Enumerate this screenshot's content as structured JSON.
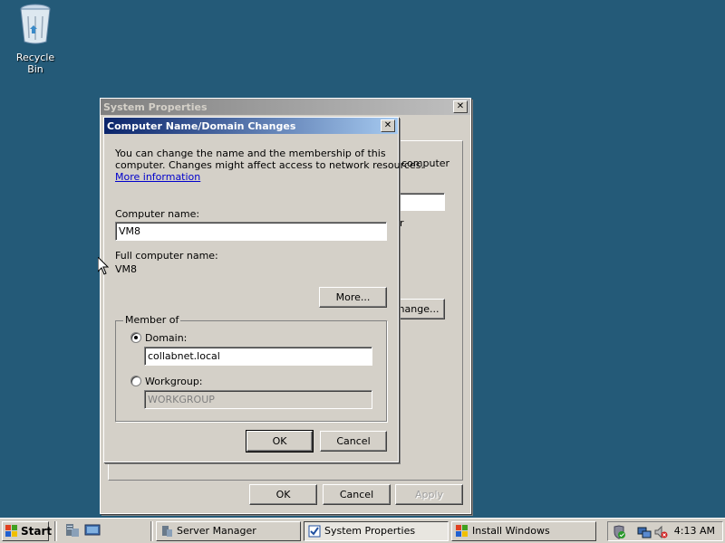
{
  "desktop": {
    "icons": [
      {
        "label": "Recycle Bin",
        "icon": "recycle-bin-icon"
      }
    ]
  },
  "system_properties": {
    "title": "System Properties",
    "partial_texts": {
      "computer": "computer",
      "r": "r"
    },
    "change_button": "hange...",
    "ok": "OK",
    "cancel": "Cancel",
    "apply": "Apply"
  },
  "dialog": {
    "title": "Computer Name/Domain Changes",
    "intro_line1": "You can change the name and the membership of this",
    "intro_line2": "computer. Changes might affect access to network resources.",
    "more_info_link": "More information",
    "computer_name_label": "Computer name:",
    "computer_name_value": "VM8",
    "full_name_label": "Full computer name:",
    "full_name_value": "VM8",
    "more_button": "More...",
    "member_of_label": "Member of",
    "domain_label": "Domain:",
    "domain_value": "collabnet.local",
    "workgroup_label": "Workgroup:",
    "workgroup_value": "WORKGROUP",
    "selected_membership": "domain",
    "ok": "OK",
    "cancel": "Cancel"
  },
  "taskbar": {
    "start": "Start",
    "buttons": [
      {
        "label": "Server Manager",
        "icon": "server-manager-icon",
        "pressed": false
      },
      {
        "label": "System Properties",
        "icon": "system-properties-icon",
        "pressed": true
      },
      {
        "label": "Install Windows",
        "icon": "windows-flag-icon",
        "pressed": false
      }
    ],
    "clock": "4:13 AM"
  },
  "colors": {
    "desktop": "#245a78",
    "active_title": "#0a246a",
    "inactive_title": "#808080",
    "link": "#0000cc"
  }
}
